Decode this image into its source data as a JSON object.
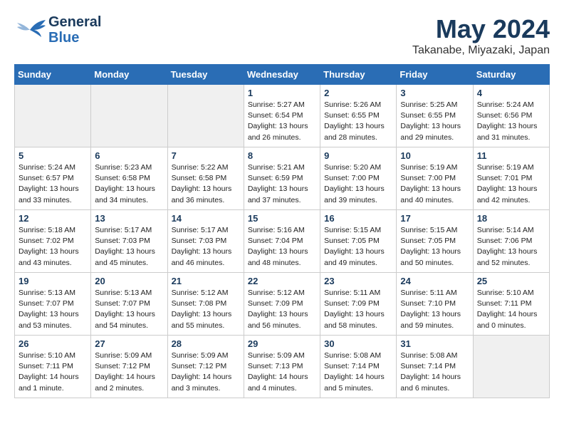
{
  "header": {
    "logo_line1": "General",
    "logo_line2": "Blue",
    "month_year": "May 2024",
    "location": "Takanabe, Miyazaki, Japan"
  },
  "days_of_week": [
    "Sunday",
    "Monday",
    "Tuesday",
    "Wednesday",
    "Thursday",
    "Friday",
    "Saturday"
  ],
  "weeks": [
    [
      {
        "day": "",
        "info": "",
        "empty": true
      },
      {
        "day": "",
        "info": "",
        "empty": true
      },
      {
        "day": "",
        "info": "",
        "empty": true
      },
      {
        "day": "1",
        "info": "Sunrise: 5:27 AM\nSunset: 6:54 PM\nDaylight: 13 hours\nand 26 minutes.",
        "empty": false
      },
      {
        "day": "2",
        "info": "Sunrise: 5:26 AM\nSunset: 6:55 PM\nDaylight: 13 hours\nand 28 minutes.",
        "empty": false
      },
      {
        "day": "3",
        "info": "Sunrise: 5:25 AM\nSunset: 6:55 PM\nDaylight: 13 hours\nand 29 minutes.",
        "empty": false
      },
      {
        "day": "4",
        "info": "Sunrise: 5:24 AM\nSunset: 6:56 PM\nDaylight: 13 hours\nand 31 minutes.",
        "empty": false
      }
    ],
    [
      {
        "day": "5",
        "info": "Sunrise: 5:24 AM\nSunset: 6:57 PM\nDaylight: 13 hours\nand 33 minutes.",
        "empty": false
      },
      {
        "day": "6",
        "info": "Sunrise: 5:23 AM\nSunset: 6:58 PM\nDaylight: 13 hours\nand 34 minutes.",
        "empty": false
      },
      {
        "day": "7",
        "info": "Sunrise: 5:22 AM\nSunset: 6:58 PM\nDaylight: 13 hours\nand 36 minutes.",
        "empty": false
      },
      {
        "day": "8",
        "info": "Sunrise: 5:21 AM\nSunset: 6:59 PM\nDaylight: 13 hours\nand 37 minutes.",
        "empty": false
      },
      {
        "day": "9",
        "info": "Sunrise: 5:20 AM\nSunset: 7:00 PM\nDaylight: 13 hours\nand 39 minutes.",
        "empty": false
      },
      {
        "day": "10",
        "info": "Sunrise: 5:19 AM\nSunset: 7:00 PM\nDaylight: 13 hours\nand 40 minutes.",
        "empty": false
      },
      {
        "day": "11",
        "info": "Sunrise: 5:19 AM\nSunset: 7:01 PM\nDaylight: 13 hours\nand 42 minutes.",
        "empty": false
      }
    ],
    [
      {
        "day": "12",
        "info": "Sunrise: 5:18 AM\nSunset: 7:02 PM\nDaylight: 13 hours\nand 43 minutes.",
        "empty": false
      },
      {
        "day": "13",
        "info": "Sunrise: 5:17 AM\nSunset: 7:03 PM\nDaylight: 13 hours\nand 45 minutes.",
        "empty": false
      },
      {
        "day": "14",
        "info": "Sunrise: 5:17 AM\nSunset: 7:03 PM\nDaylight: 13 hours\nand 46 minutes.",
        "empty": false
      },
      {
        "day": "15",
        "info": "Sunrise: 5:16 AM\nSunset: 7:04 PM\nDaylight: 13 hours\nand 48 minutes.",
        "empty": false
      },
      {
        "day": "16",
        "info": "Sunrise: 5:15 AM\nSunset: 7:05 PM\nDaylight: 13 hours\nand 49 minutes.",
        "empty": false
      },
      {
        "day": "17",
        "info": "Sunrise: 5:15 AM\nSunset: 7:05 PM\nDaylight: 13 hours\nand 50 minutes.",
        "empty": false
      },
      {
        "day": "18",
        "info": "Sunrise: 5:14 AM\nSunset: 7:06 PM\nDaylight: 13 hours\nand 52 minutes.",
        "empty": false
      }
    ],
    [
      {
        "day": "19",
        "info": "Sunrise: 5:13 AM\nSunset: 7:07 PM\nDaylight: 13 hours\nand 53 minutes.",
        "empty": false
      },
      {
        "day": "20",
        "info": "Sunrise: 5:13 AM\nSunset: 7:07 PM\nDaylight: 13 hours\nand 54 minutes.",
        "empty": false
      },
      {
        "day": "21",
        "info": "Sunrise: 5:12 AM\nSunset: 7:08 PM\nDaylight: 13 hours\nand 55 minutes.",
        "empty": false
      },
      {
        "day": "22",
        "info": "Sunrise: 5:12 AM\nSunset: 7:09 PM\nDaylight: 13 hours\nand 56 minutes.",
        "empty": false
      },
      {
        "day": "23",
        "info": "Sunrise: 5:11 AM\nSunset: 7:09 PM\nDaylight: 13 hours\nand 58 minutes.",
        "empty": false
      },
      {
        "day": "24",
        "info": "Sunrise: 5:11 AM\nSunset: 7:10 PM\nDaylight: 13 hours\nand 59 minutes.",
        "empty": false
      },
      {
        "day": "25",
        "info": "Sunrise: 5:10 AM\nSunset: 7:11 PM\nDaylight: 14 hours\nand 0 minutes.",
        "empty": false
      }
    ],
    [
      {
        "day": "26",
        "info": "Sunrise: 5:10 AM\nSunset: 7:11 PM\nDaylight: 14 hours\nand 1 minute.",
        "empty": false
      },
      {
        "day": "27",
        "info": "Sunrise: 5:09 AM\nSunset: 7:12 PM\nDaylight: 14 hours\nand 2 minutes.",
        "empty": false
      },
      {
        "day": "28",
        "info": "Sunrise: 5:09 AM\nSunset: 7:12 PM\nDaylight: 14 hours\nand 3 minutes.",
        "empty": false
      },
      {
        "day": "29",
        "info": "Sunrise: 5:09 AM\nSunset: 7:13 PM\nDaylight: 14 hours\nand 4 minutes.",
        "empty": false
      },
      {
        "day": "30",
        "info": "Sunrise: 5:08 AM\nSunset: 7:14 PM\nDaylight: 14 hours\nand 5 minutes.",
        "empty": false
      },
      {
        "day": "31",
        "info": "Sunrise: 5:08 AM\nSunset: 7:14 PM\nDaylight: 14 hours\nand 6 minutes.",
        "empty": false
      },
      {
        "day": "",
        "info": "",
        "empty": true
      }
    ]
  ]
}
